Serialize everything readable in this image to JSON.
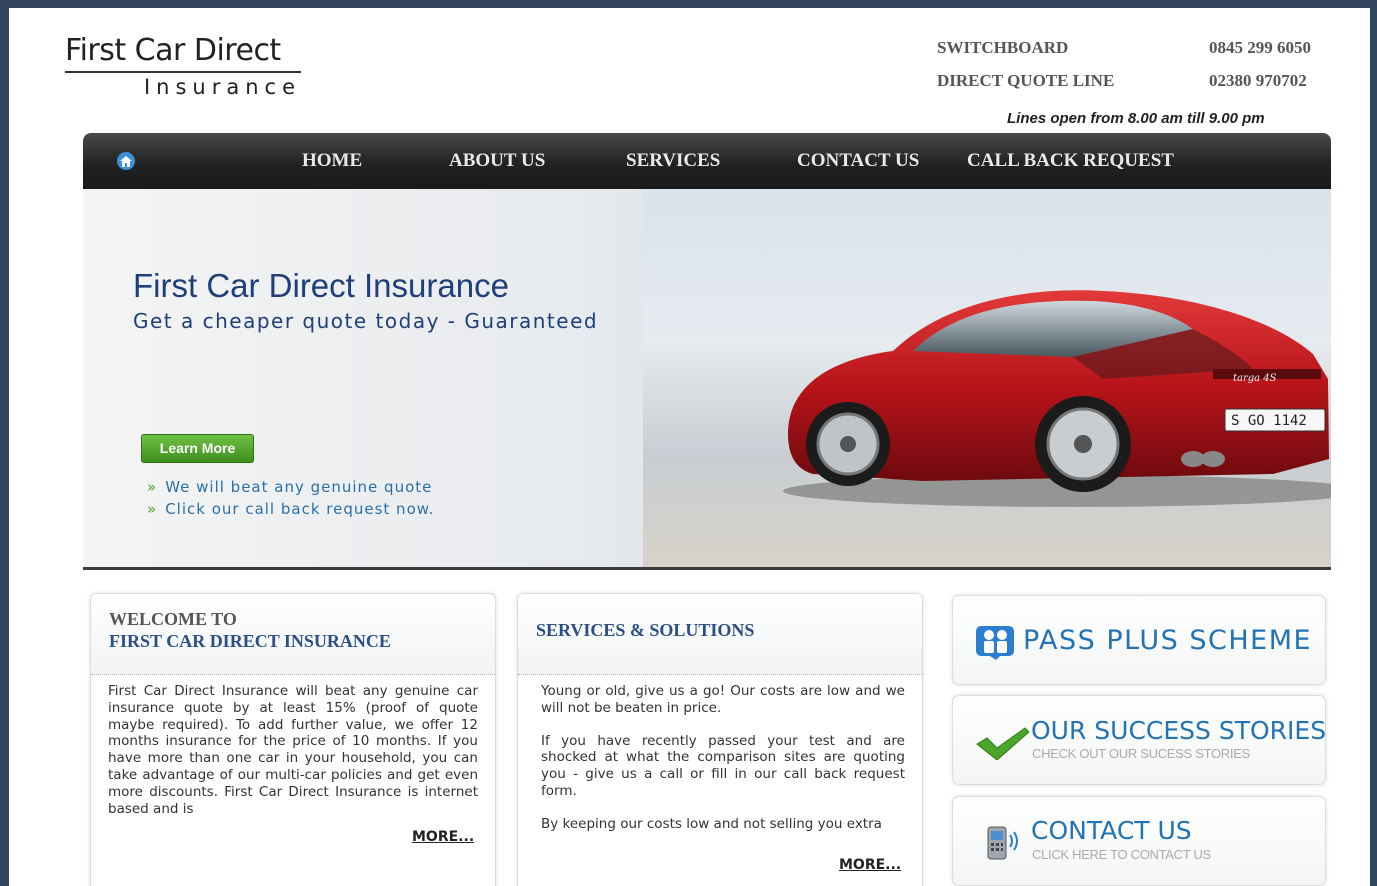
{
  "logo": {
    "main": "First Car Direct",
    "sub": "Insurance"
  },
  "contact": {
    "rows": [
      {
        "label": "SWITCHBOARD",
        "number": "0845 299 6050"
      },
      {
        "label": "DIRECT QUOTE LINE",
        "number": "02380 970702"
      }
    ],
    "hours": "Lines open from 8.00 am till 9.00 pm"
  },
  "nav": {
    "items": [
      "HOME",
      "ABOUT US",
      "SERVICES",
      "CONTACT US",
      "CALL BACK REQUEST"
    ]
  },
  "hero": {
    "title": "First Car Direct Insurance",
    "subtitle": "Get a cheaper quote today - Guaranteed",
    "button": "Learn More",
    "bullets": [
      "We will beat any genuine quote",
      "Click our call back request now."
    ],
    "plate": "S GO 1142",
    "badge": "targa 4S"
  },
  "welcome": {
    "heading1": "WELCOME TO",
    "heading2": "FIRST CAR DIRECT INSURANCE",
    "text": "First Car Direct Insurance will beat any genuine car insurance quote by at least 15% (proof of quote maybe required). To add further value, we offer 12 months insurance for the price of 10 months. If you have more than one car in your household, you can take advantage of our multi-car policies and get even more discounts. First Car Direct Insurance is internet based and is",
    "more": "MORE..."
  },
  "services": {
    "heading": "SERVICES & SOLUTIONS",
    "paragraphs": [
      "Young or old, give us a go! Our costs are low and we will not be beaten in price.",
      "If you have recently passed your test and are shocked at what the comparison sites are quoting you - give us a call or fill in our call back request form.",
      "By keeping our costs low and not selling you extra"
    ],
    "more": "MORE..."
  },
  "side": {
    "pass_plus": {
      "title": "PASS PLUS SCHEME"
    },
    "success": {
      "title": "OUR SUCCESS STORIES",
      "sub": "CHECK OUT OUR SUCESS STORIES"
    },
    "contact": {
      "title": "CONTACT US",
      "sub": "CLICK HERE TO CONTACT US"
    }
  },
  "colors": {
    "accent_blue": "#2273b4",
    "heading_blue": "#2b4f84",
    "green_button": "#4fa62c",
    "frame": "#34465e"
  }
}
